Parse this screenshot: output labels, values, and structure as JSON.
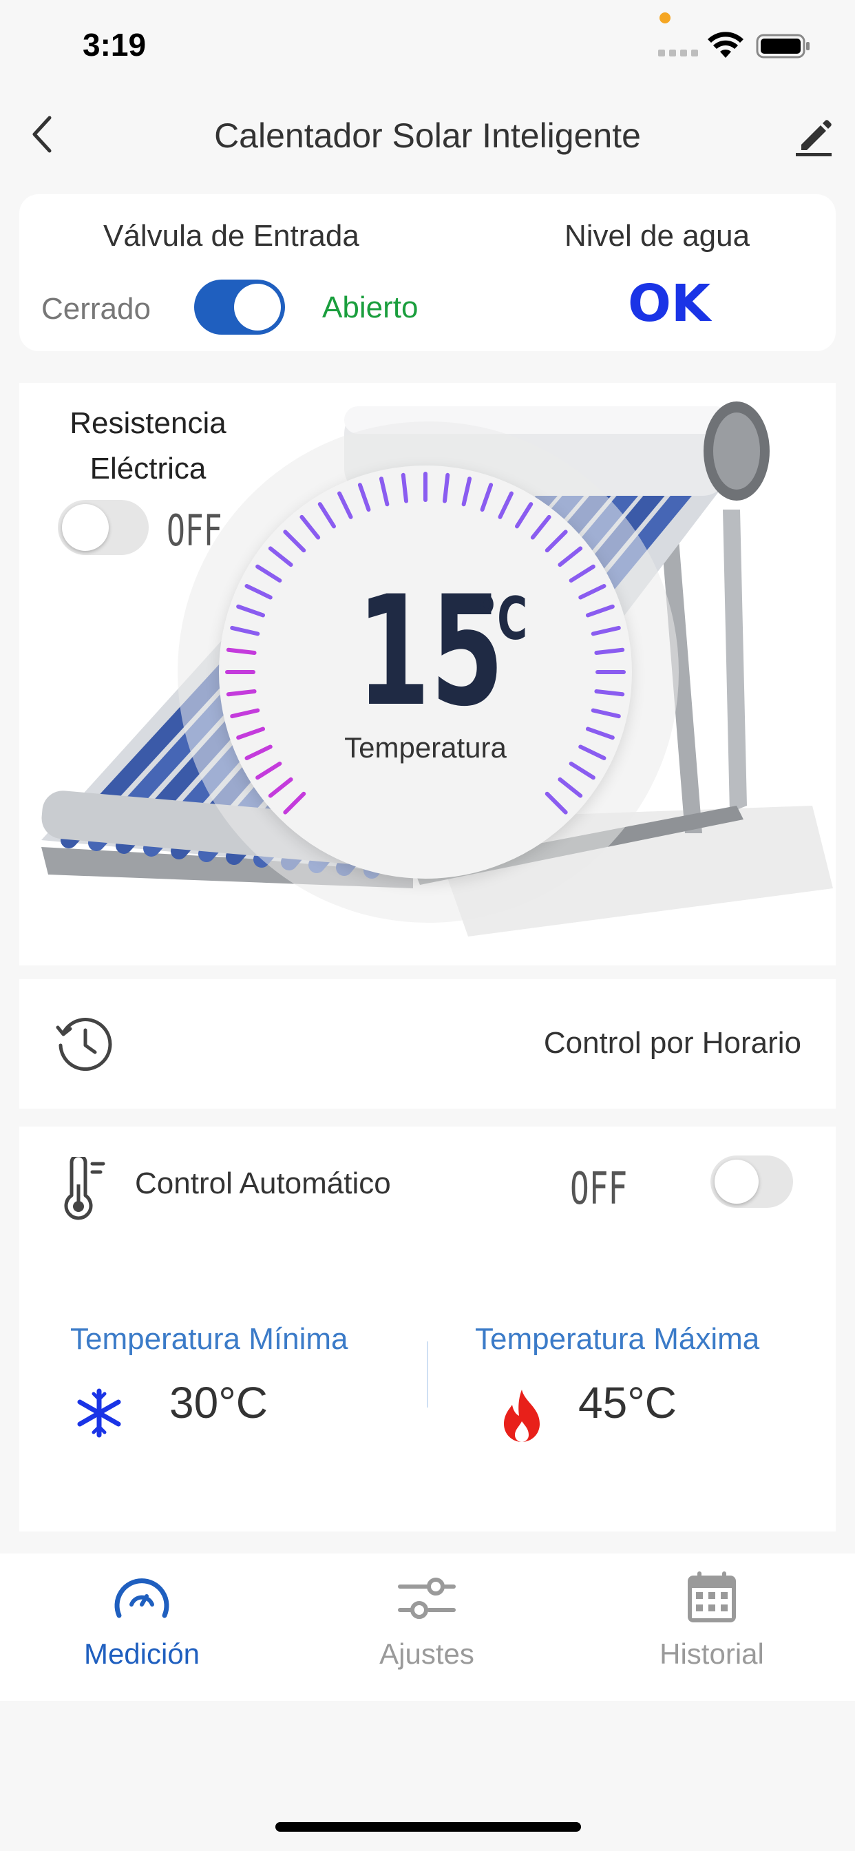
{
  "status_bar": {
    "time": "3:19"
  },
  "header": {
    "title": "Calentador Solar Inteligente",
    "back_icon": "chevron-left-icon",
    "edit_icon": "pencil-icon"
  },
  "valve": {
    "title": "Válvula de Entrada",
    "closed_label": "Cerrado",
    "open_label": "Abierto",
    "is_open": true
  },
  "water_level": {
    "title": "Nivel de agua",
    "value": "OK"
  },
  "resistance": {
    "label_line1": "Resistencia",
    "label_line2": "Eléctrica",
    "state_text": "OFF",
    "is_on": false
  },
  "temperature": {
    "value": "15",
    "unit": "°C",
    "label": "Temperatura"
  },
  "schedule": {
    "label": "Control por Horario",
    "icon": "clock-icon"
  },
  "auto_control": {
    "label": "Control Automático",
    "state_text": "OFF",
    "is_on": false,
    "min": {
      "title": "Temperatura Mínima",
      "value": "30°C",
      "icon": "snowflake-icon"
    },
    "max": {
      "title": "Temperatura Máxima",
      "value": "45°C",
      "icon": "fire-icon"
    }
  },
  "tabs": [
    {
      "label": "Medición",
      "icon": "gauge-icon",
      "active": true
    },
    {
      "label": "Ajustes",
      "icon": "sliders-icon",
      "active": false
    },
    {
      "label": "Historial",
      "icon": "calendar-icon",
      "active": false
    }
  ],
  "colors": {
    "accent": "#1f5fbf",
    "ok_blue": "#1a34e6",
    "open_green": "#1a9e3d",
    "link_blue": "#3b7bc8"
  }
}
